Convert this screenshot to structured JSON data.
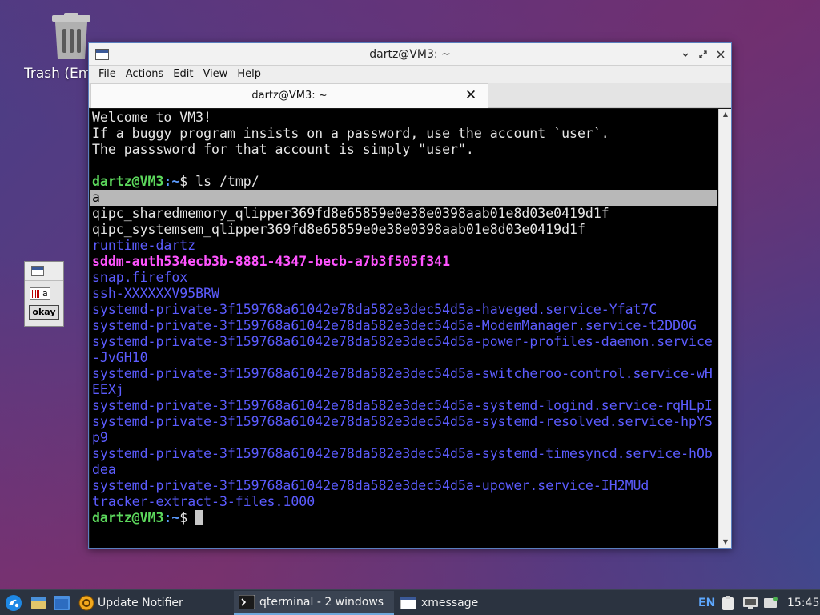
{
  "desktop": {
    "trash_label": "Trash (Em"
  },
  "xmessage": {
    "text": "a",
    "button_label": "okay"
  },
  "window": {
    "title": "dartz@VM3: ~",
    "menus": [
      "File",
      "Actions",
      "Edit",
      "View",
      "Help"
    ],
    "tab_label": "dartz@VM3: ~"
  },
  "terminal": {
    "motd": [
      "Welcome to VM3!",
      "If a buggy program insists on a password, use the account `user`.",
      "The passsword for that account is simply \"user\"."
    ],
    "prompt_user": "dartz@VM3",
    "prompt_path": ":~",
    "prompt_sign": "$",
    "command": " ls /tmp/",
    "listing": [
      {
        "text": "a",
        "style": "hl"
      },
      {
        "text": "qipc_sharedmemory_qlipper369fd8e65859e0e38e0398aab01e8d03e0419d1f",
        "style": "plain"
      },
      {
        "text": "qipc_systemsem_qlipper369fd8e65859e0e38e0398aab01e8d03e0419d1f",
        "style": "plain"
      },
      {
        "text": "runtime-dartz",
        "style": "blue"
      },
      {
        "text": "sddm-auth534ecb3b-8881-4347-becb-a7b3f505f341",
        "style": "magenta"
      },
      {
        "text": "snap.firefox",
        "style": "blue"
      },
      {
        "text": "ssh-XXXXXXV95BRW",
        "style": "blue"
      },
      {
        "text": "systemd-private-3f159768a61042e78da582e3dec54d5a-haveged.service-Yfat7C",
        "style": "blue"
      },
      {
        "text": "systemd-private-3f159768a61042e78da582e3dec54d5a-ModemManager.service-t2DD0G",
        "style": "blue"
      },
      {
        "text": "systemd-private-3f159768a61042e78da582e3dec54d5a-power-profiles-daemon.service",
        "style": "blue"
      },
      {
        "text": "-JvGH10",
        "style": "blue"
      },
      {
        "text": "systemd-private-3f159768a61042e78da582e3dec54d5a-switcheroo-control.service-wH",
        "style": "blue"
      },
      {
        "text": "EEXj",
        "style": "blue"
      },
      {
        "text": "systemd-private-3f159768a61042e78da582e3dec54d5a-systemd-logind.service-rqHLpI",
        "style": "blue"
      },
      {
        "text": "systemd-private-3f159768a61042e78da582e3dec54d5a-systemd-resolved.service-hpYS",
        "style": "blue"
      },
      {
        "text": "p9",
        "style": "blue"
      },
      {
        "text": "systemd-private-3f159768a61042e78da582e3dec54d5a-systemd-timesyncd.service-hOb",
        "style": "blue"
      },
      {
        "text": "dea",
        "style": "blue"
      },
      {
        "text": "systemd-private-3f159768a61042e78da582e3dec54d5a-upower.service-IH2MUd",
        "style": "blue"
      },
      {
        "text": "tracker-extract-3-files.1000",
        "style": "blue"
      }
    ]
  },
  "taskbar": {
    "notifier_label": "Update Notifier",
    "tasks": [
      {
        "label": "qterminal - 2 windows",
        "icon": "terminal-icon"
      },
      {
        "label": "xmessage",
        "icon": "window-icon"
      }
    ],
    "keyboard_layout": "EN",
    "clock": "15:45"
  },
  "colors": {
    "terminal_bg": "#000000",
    "dir_blue": "#5c5cff",
    "socket_magenta": "#ff54ff",
    "prompt_green": "#5cd85c",
    "taskbar_bg": "#2b3340"
  }
}
